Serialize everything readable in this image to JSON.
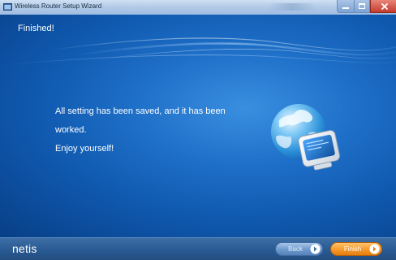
{
  "window": {
    "title": "Wireless Router Setup Wizard"
  },
  "header": {
    "step_title": "Finished!"
  },
  "main": {
    "message_lines": [
      "All setting has been saved, and it has been",
      "worked.",
      "Enjoy yourself!"
    ]
  },
  "footer": {
    "brand": "netis",
    "back_label": "Back",
    "finish_label": "Finish"
  },
  "icons": {
    "app": "window-icon",
    "minimize": "minimize-icon",
    "maximize": "maximize-icon",
    "close": "close-icon",
    "illustration": "globe-computer-icon",
    "back_arrow": "arrow-right-circle-icon",
    "finish_arrow": "arrow-right-circle-icon"
  },
  "colors": {
    "background_blue": "#1e6fc8",
    "finish_orange": "#f79a2a",
    "close_red": "#c43c2e"
  }
}
